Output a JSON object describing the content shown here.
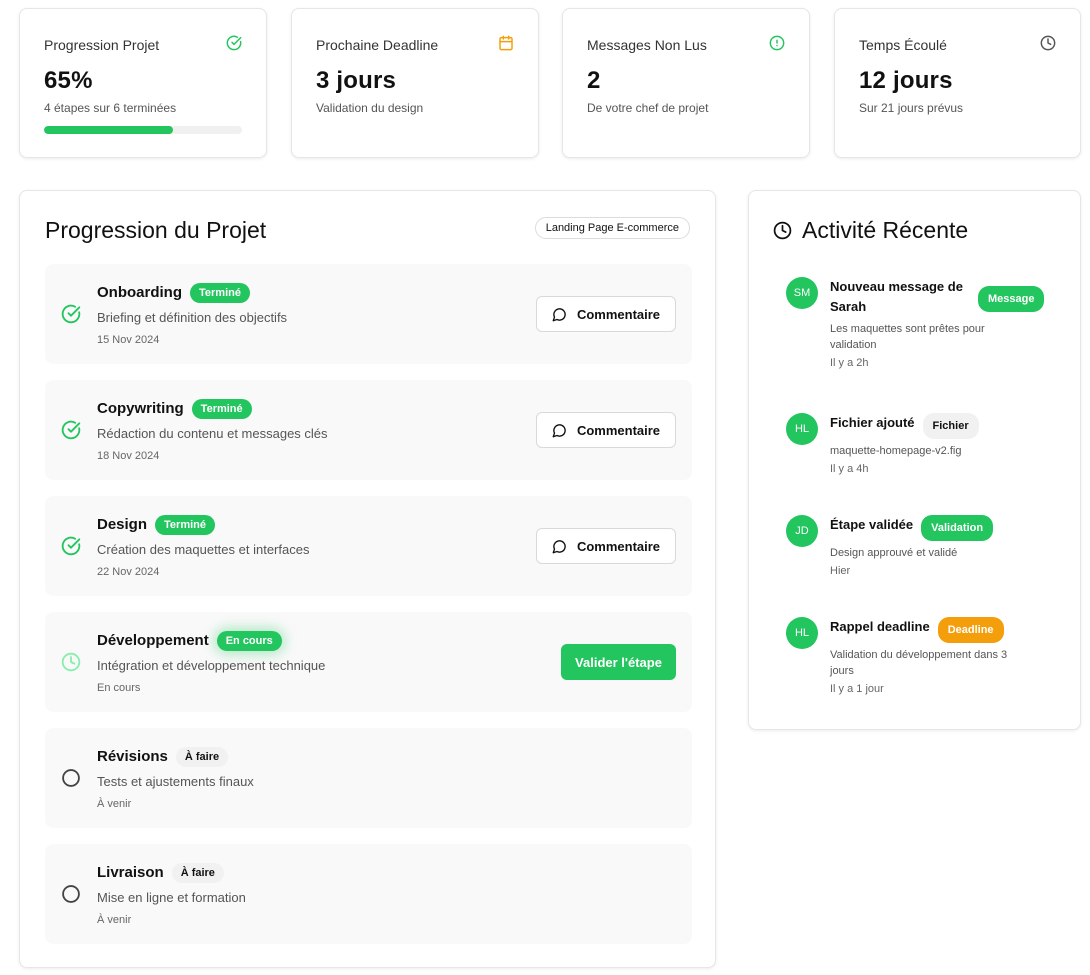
{
  "stats": [
    {
      "title": "Progression Projet",
      "value": "65%",
      "sub": "4 étapes sur 6 terminées",
      "icon": "check-circle-icon",
      "icon_color": "#22c55e",
      "progress": 0.65
    },
    {
      "title": "Prochaine Deadline",
      "value": "3 jours",
      "sub": "Validation du design",
      "icon": "calendar-icon",
      "icon_color": "#f59e0b"
    },
    {
      "title": "Messages Non Lus",
      "value": "2",
      "sub": "De votre chef de projet",
      "icon": "alert-circle-icon",
      "icon_color": "#22c55e"
    },
    {
      "title": "Temps Écoulé",
      "value": "12 jours",
      "sub": "Sur 21 jours prévus",
      "icon": "clock-icon",
      "icon_color": "#555555"
    }
  ],
  "progress_panel": {
    "title": "Progression du Projet",
    "project_tag": "Landing Page E-commerce",
    "steps": [
      {
        "name": "Onboarding",
        "badge": "Terminé",
        "status": "done",
        "desc": "Briefing et définition des objectifs",
        "date": "15 Nov 2024",
        "action": "Commentaire"
      },
      {
        "name": "Copywriting",
        "badge": "Terminé",
        "status": "done",
        "desc": "Rédaction du contenu et messages clés",
        "date": "18 Nov 2024",
        "action": "Commentaire"
      },
      {
        "name": "Design",
        "badge": "Terminé",
        "status": "done",
        "desc": "Création des maquettes et interfaces",
        "date": "22 Nov 2024",
        "action": "Commentaire"
      },
      {
        "name": "Développement",
        "badge": "En cours",
        "status": "progress",
        "desc": "Intégration et développement technique",
        "date": "En cours",
        "action": "Valider l'étape"
      },
      {
        "name": "Révisions",
        "badge": "À faire",
        "status": "todo",
        "desc": "Tests et ajustements finaux",
        "date": "À venir"
      },
      {
        "name": "Livraison",
        "badge": "À faire",
        "status": "todo",
        "desc": "Mise en ligne et formation",
        "date": "À venir"
      }
    ]
  },
  "activity": {
    "title": "Activité Récente",
    "items": [
      {
        "initials": "SM",
        "title": "Nouveau message de Sarah",
        "badge": "Message",
        "badge_style": "green",
        "desc": "Les maquettes sont prêtes pour validation",
        "time": "Il y a 2h"
      },
      {
        "initials": "HL",
        "title": "Fichier ajouté",
        "badge": "Fichier",
        "badge_style": "gray",
        "desc": "maquette-homepage-v2.fig",
        "time": "Il y a 4h"
      },
      {
        "initials": "JD",
        "title": "Étape validée",
        "badge": "Validation",
        "badge_style": "green",
        "desc": "Design approuvé et validé",
        "time": "Hier"
      },
      {
        "initials": "HL",
        "title": "Rappel deadline",
        "badge": "Deadline",
        "badge_style": "orange",
        "desc": "Validation du développement dans 3 jours",
        "time": "Il y a 1 jour"
      }
    ]
  },
  "colors": {
    "accent": "#22c55e",
    "warning": "#f59e0b"
  }
}
